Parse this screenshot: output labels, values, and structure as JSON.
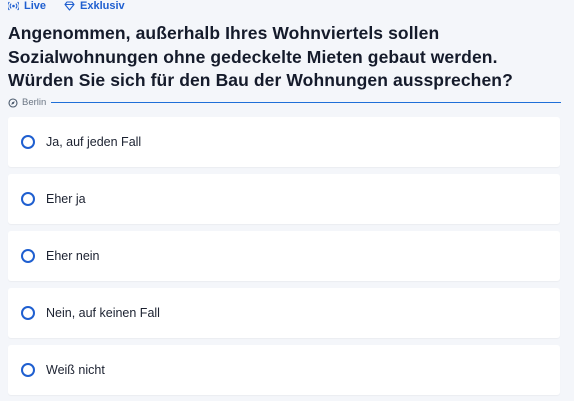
{
  "tags": [
    {
      "icon": "broadcast-icon",
      "label": "Live"
    },
    {
      "icon": "diamond-icon",
      "label": "Exklusiv"
    }
  ],
  "question": "Angenommen, außerhalb Ihres Wohnviertels sollen Sozialwohnun­gen ohne gedeckelte Mieten gebaut werden. Würden Sie sich für den Bau der Wohnungen aussprechen?",
  "source": {
    "icon": "compass-icon",
    "label": "Berlin"
  },
  "options": [
    {
      "label": "Ja, auf jeden Fall",
      "selected": false
    },
    {
      "label": "Eher ja",
      "selected": false
    },
    {
      "label": "Eher nein",
      "selected": false
    },
    {
      "label": "Nein, auf keinen Fall",
      "selected": false
    },
    {
      "label": "Weiß nicht",
      "selected": false
    }
  ],
  "colors": {
    "accent": "#1f5fd0",
    "background": "#f4f6fa",
    "card": "#ffffff",
    "text": "#151b2b"
  }
}
